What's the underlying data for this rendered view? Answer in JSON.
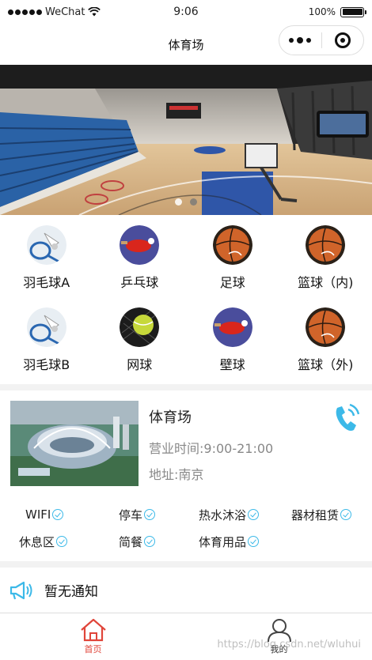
{
  "status_bar": {
    "carrier": "WeChat",
    "time": "9:06",
    "battery": "100%",
    "battery_level": 1.0
  },
  "nav": {
    "title": "体育场"
  },
  "banner": {
    "image": "indoor basketball arena photo",
    "slide_count": 2,
    "active_slide": 1
  },
  "categories": [
    {
      "label": "羽毛球A",
      "icon": "badminton-shuttlecock-icon"
    },
    {
      "label": "乒乓球",
      "icon": "table-tennis-paddle-icon"
    },
    {
      "label": "足球",
      "icon": "ball-icon"
    },
    {
      "label": "篮球（内)",
      "icon": "basketball-icon"
    },
    {
      "label": "羽毛球B",
      "icon": "badminton-shuttlecock-icon"
    },
    {
      "label": "网球",
      "icon": "tennis-ball-icon"
    },
    {
      "label": "壁球",
      "icon": "table-tennis-paddle-icon"
    },
    {
      "label": "篮球（外)",
      "icon": "basketball-icon"
    }
  ],
  "venue": {
    "name": "体育场",
    "hours": "营业时间:9:00-21:00",
    "address": "地址:南京",
    "phone_icon": "phone-icon",
    "image": "stadium aerial photo"
  },
  "amenities": [
    [
      "WIFI",
      "停车",
      "热水沐浴",
      "器材租赁"
    ],
    [
      "休息区",
      "简餐",
      "体育用品"
    ]
  ],
  "notice": {
    "text": "暂无通知",
    "icon": "megaphone-icon"
  },
  "tabbar": {
    "home_label": "首页",
    "mine_label": "我的"
  },
  "watermark": "https://blog.csdn.net/wluhui",
  "colors": {
    "accent": "#3cb9e8",
    "active_tab": "#e0453a"
  }
}
